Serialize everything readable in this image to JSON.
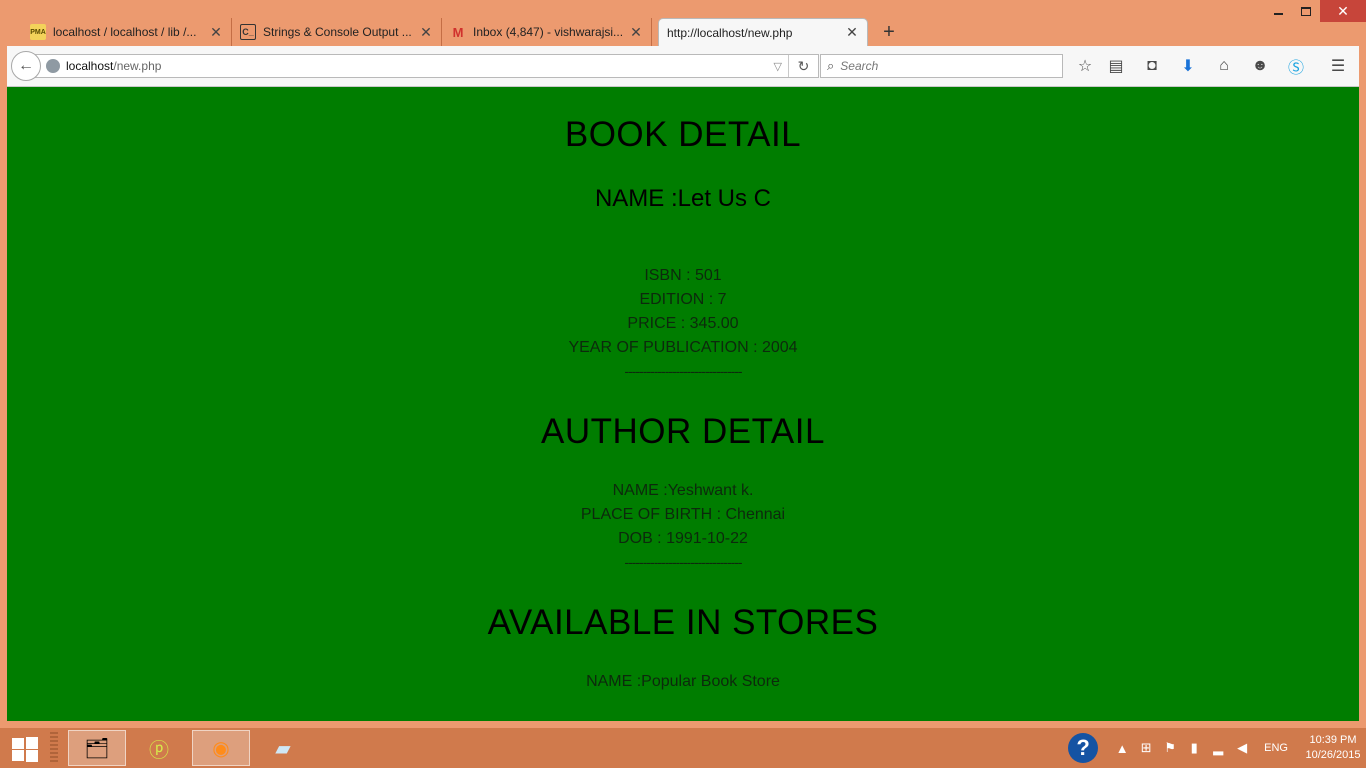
{
  "window": {
    "min_icon": "minimize-icon",
    "max_icon": "maximize-icon",
    "close_glyph": "✕"
  },
  "tabs": [
    {
      "title": "localhost / localhost / lib /...",
      "icon": "phpmyadmin-icon",
      "favicon": "PMA",
      "close": "✕"
    },
    {
      "title": "Strings & Console Output ...",
      "icon": "code-icon",
      "favicon": "C_",
      "close": "✕"
    },
    {
      "title": "Inbox (4,847) - vishwarajsi...",
      "icon": "gmail-icon",
      "favicon": "M",
      "close": "✕"
    },
    {
      "title": "http://localhost/new.php",
      "icon": "none",
      "close": "✕",
      "active": true
    }
  ],
  "new_tab": "+",
  "toolbar": {
    "url_host": "localhost",
    "url_path": "/new.php",
    "search_placeholder": "Search",
    "back_glyph": "←",
    "reload_glyph": "↻",
    "drop_glyph": "▽",
    "search_glyph": "🔍"
  },
  "page": {
    "book_heading": "BOOK DETAIL",
    "book_name": "NAME :Let Us C",
    "isbn": "ISBN : 501",
    "edition": "EDITION : 7",
    "price": "PRICE : 345.00",
    "year": "YEAR OF PUBLICATION : 2004",
    "separator1": "--------------------------------",
    "author_heading": "AUTHOR DETAIL",
    "author_name": "NAME :Yeshwant k.",
    "birthplace": "PLACE OF BIRTH : Chennai",
    "dob": "DOB : 1991-10-22",
    "separator2": "--------------------------------",
    "stores_heading": "AVAILABLE IN STORES",
    "store_name": "NAME :Popular Book Store"
  },
  "colors": {
    "page_bg": "#007d00",
    "frame": "#ec9a6f",
    "taskbar": "#d07a4c",
    "close_btn": "#c7453a"
  },
  "taskbar": {
    "tray_lang": "ENG",
    "clock_time": "10:39 PM",
    "clock_date": "10/26/2015",
    "help_glyph": "?"
  }
}
